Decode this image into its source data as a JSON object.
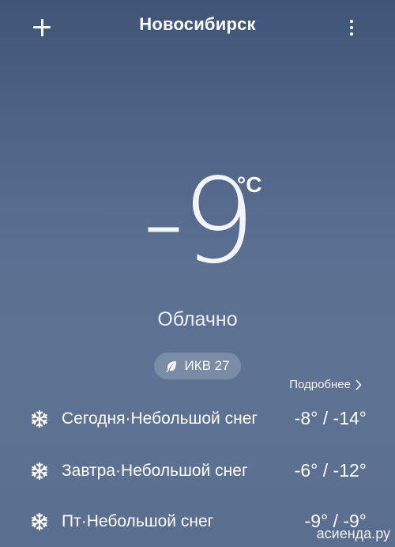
{
  "header": {
    "city": "Новосибирск",
    "add_icon": "plus-icon",
    "menu_icon": "more-vertical-icon"
  },
  "current": {
    "temperature": "-9",
    "unit": "°C",
    "condition": "Облачно"
  },
  "aqi": {
    "label": "ИКВ 27",
    "icon": "leaf-icon"
  },
  "details_link": "Подробнее",
  "forecast": [
    {
      "icon": "snowflake-icon",
      "label": "Сегодня·Небольшой снег",
      "range": "-8° / -14°"
    },
    {
      "icon": "snowflake-icon",
      "label": "Завтра·Небольшой снег",
      "range": "-6° / -12°"
    },
    {
      "icon": "snowflake-icon",
      "label": "Пт·Небольшой снег",
      "range": "-9° / -9°"
    }
  ],
  "watermark": "асиенда.ру"
}
